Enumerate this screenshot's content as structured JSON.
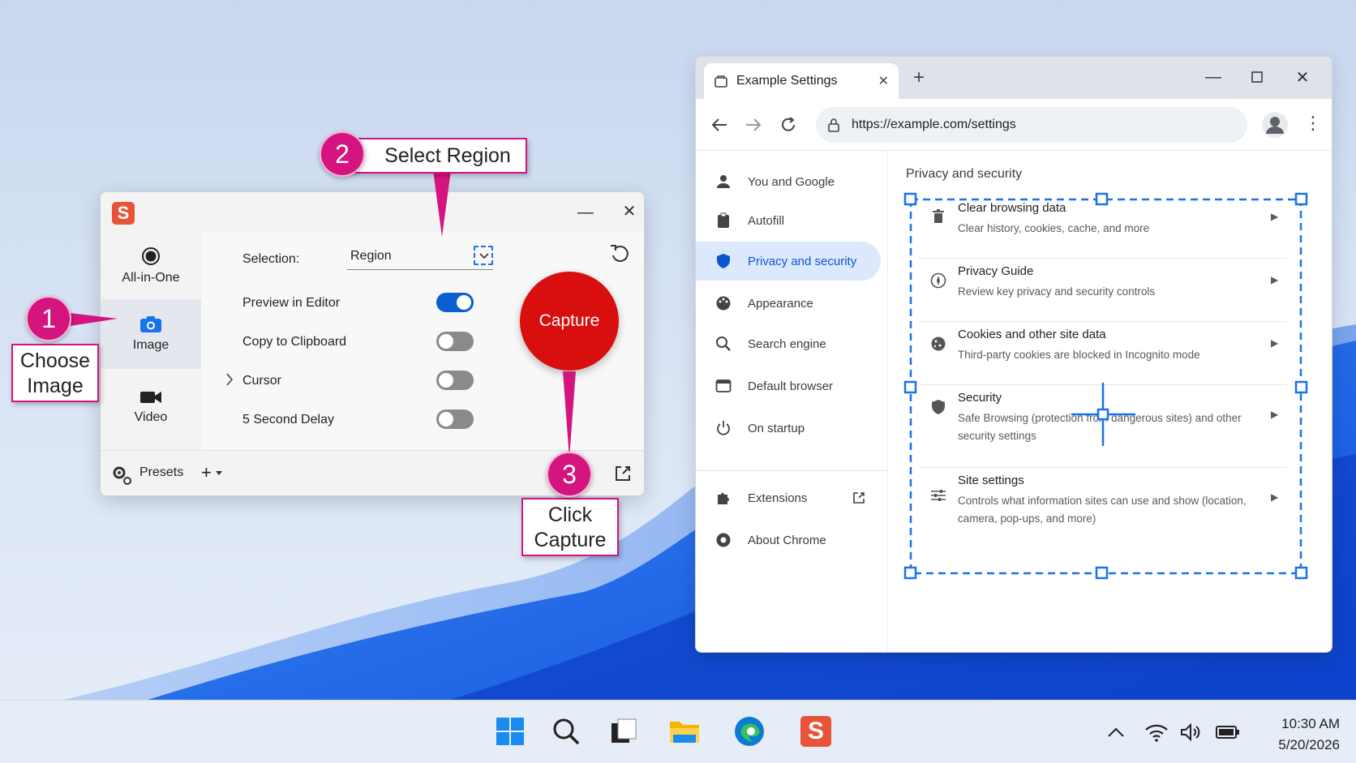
{
  "snagit": {
    "modes": [
      {
        "label": "All-in-One",
        "icon": "record-icon"
      },
      {
        "label": "Image",
        "icon": "camera-icon"
      },
      {
        "label": "Video",
        "icon": "video-camera-icon"
      }
    ],
    "selection_label": "Selection:",
    "selection_value": "Region",
    "options": [
      {
        "label": "Preview in Editor",
        "on": true
      },
      {
        "label": "Copy to Clipboard",
        "on": false
      },
      {
        "label": "Cursor",
        "on": false
      },
      {
        "label": "5 Second Delay",
        "on": false
      }
    ],
    "capture_label": "Capture",
    "presets_label": "Presets"
  },
  "chrome": {
    "tab_title": "Example Settings",
    "url": "https://example.com/settings",
    "nav": [
      {
        "label": "You and Google",
        "icon": "person-icon"
      },
      {
        "label": "Autofill",
        "icon": "clipboard-icon"
      },
      {
        "label": "Privacy and security",
        "icon": "shield-icon",
        "active": true
      },
      {
        "label": "Appearance",
        "icon": "palette-icon"
      },
      {
        "label": "Search engine",
        "icon": "search-icon"
      },
      {
        "label": "Default browser",
        "icon": "browser-icon"
      },
      {
        "label": "On startup",
        "icon": "power-icon"
      },
      {
        "label": "Extensions",
        "icon": "puzzle-icon"
      },
      {
        "label": "About Chrome",
        "icon": "chrome-icon"
      }
    ],
    "section_title": "Privacy and security",
    "settings": [
      {
        "title": "Clear browsing data",
        "desc": "Clear history, cookies, cache, and more",
        "icon": "trash-icon"
      },
      {
        "title": "Privacy Guide",
        "desc": "Review key privacy and security controls",
        "icon": "compass-icon"
      },
      {
        "title": "Cookies and other site data",
        "desc": "Third-party cookies are blocked in Incognito mode",
        "icon": "cookie-icon"
      },
      {
        "title": "Security",
        "desc": "Safe Browsing (protection from dangerous sites) and other security settings",
        "icon": "shield-icon"
      },
      {
        "title": "Site settings",
        "desc": "Controls what information sites can use and show (location, camera, pop-ups, and more)",
        "icon": "sliders-icon"
      }
    ]
  },
  "callouts": {
    "one": {
      "number": "1",
      "text_line1": "Choose",
      "text_line2": "Image"
    },
    "two": {
      "number": "2",
      "text": "Select Region"
    },
    "three": {
      "number": "3",
      "text_line1": "Click",
      "text_line2": "Capture"
    }
  },
  "taskbar": {
    "time": "10:30 AM",
    "date": "5/20/2026",
    "apps": [
      "windows-start-icon",
      "search-icon",
      "task-view-icon",
      "file-explorer-icon",
      "edge-icon",
      "snagit-icon"
    ]
  },
  "colors": {
    "accent": "#d4147f",
    "capture": "#d90f0f",
    "chrome_blue": "#0b57d0",
    "selection_dash": "#1a73e8"
  }
}
